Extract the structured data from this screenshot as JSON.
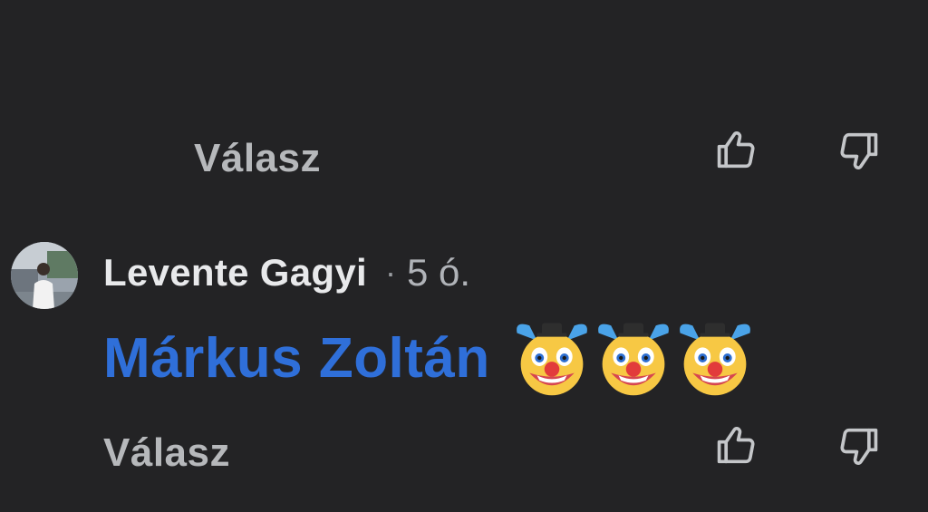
{
  "previous_comment": {
    "reply_label": "Válasz"
  },
  "comment": {
    "author": "Levente Gagyi",
    "separator": "·",
    "time": "5 ó.",
    "mention": "Márkus Zoltán",
    "emojis": [
      "clown-face-emoji",
      "clown-face-emoji",
      "clown-face-emoji"
    ],
    "reply_label": "Válasz"
  },
  "icons": {
    "like": "thumbs-up-icon",
    "dislike": "thumbs-down-icon"
  },
  "colors": {
    "background": "#232325",
    "mention": "#2f6fd9",
    "author": "#e8e9eb",
    "muted": "#b6b8bb"
  }
}
